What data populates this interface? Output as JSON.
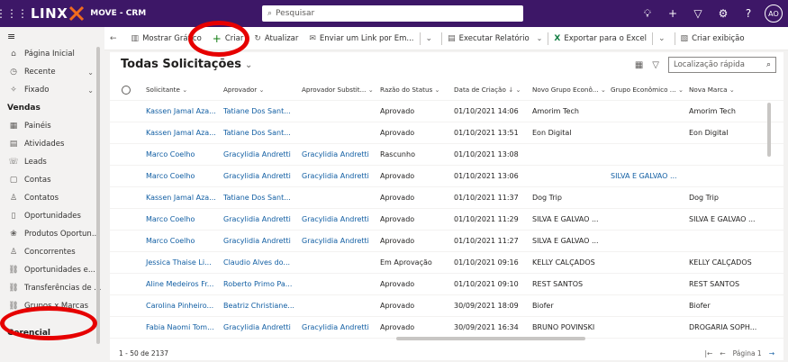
{
  "topbar": {
    "logo_text": "LINX",
    "app_name": "MOVE - CRM",
    "search_placeholder": "Pesquisar",
    "avatar_initials": "AO"
  },
  "sidebar": {
    "items_top": [
      {
        "label": "Página Inicial",
        "icon": "home-icon"
      },
      {
        "label": "Recente",
        "icon": "clock-icon",
        "chevron": true
      },
      {
        "label": "Fixado",
        "icon": "pin-icon",
        "chevron": true
      }
    ],
    "section_vendas": "Vendas",
    "items_vendas": [
      {
        "label": "Painéis",
        "icon": "dashboard-icon"
      },
      {
        "label": "Atividades",
        "icon": "activities-icon"
      },
      {
        "label": "Leads",
        "icon": "leads-icon"
      },
      {
        "label": "Contas",
        "icon": "accounts-icon"
      },
      {
        "label": "Contatos",
        "icon": "contact-icon"
      },
      {
        "label": "Oportunidades",
        "icon": "opportunity-icon"
      },
      {
        "label": "Produtos Oportun...",
        "icon": "products-icon"
      },
      {
        "label": "Concorrentes",
        "icon": "competitor-icon"
      },
      {
        "label": "Oportunidades e...",
        "icon": "link-icon"
      },
      {
        "label": "Transferências de ...",
        "icon": "link-icon"
      },
      {
        "label": "Grupos x Marcas",
        "icon": "link-icon"
      }
    ],
    "section_gerencial": "Gerencial"
  },
  "commands": {
    "mostrar_grafico": "Mostrar Gráfico",
    "criar": "Criar",
    "atualizar": "Atualizar",
    "enviar_link": "Enviar um Link por Em...",
    "executar_relatorio": "Executar Relatório",
    "exportar_excel": "Exportar para o Excel",
    "criar_exibicao": "Criar exibição"
  },
  "view": {
    "title": "Todas Solicitações",
    "quick_find_placeholder": "Localização rápida"
  },
  "grid": {
    "headers": [
      "Solicitante",
      "Aprovador",
      "Aprovador Substit...",
      "Razão do Status",
      "Data de Criação",
      "Novo Grupo Econô...",
      "Grupo Econômico ...",
      "Nova Marca"
    ],
    "rows": [
      [
        "Kassen Jamal Aza...",
        "Tatiane Dos Sant...",
        "",
        "Aprovado",
        "01/10/2021 14:06",
        "Amorim Tech",
        "",
        "Amorim Tech"
      ],
      [
        "Kassen Jamal Aza...",
        "Tatiane Dos Sant...",
        "",
        "Aprovado",
        "01/10/2021 13:51",
        "Eon Digital",
        "",
        "Eon Digital"
      ],
      [
        "Marco Coelho",
        "Gracylidia Andretti",
        "Gracylidia Andretti",
        "Rascunho",
        "01/10/2021 13:08",
        "",
        "",
        ""
      ],
      [
        "Marco Coelho",
        "Gracylidia Andretti",
        "Gracylidia Andretti",
        "Aprovado",
        "01/10/2021 13:06",
        "",
        "SILVA E GALVAO ...",
        ""
      ],
      [
        "Kassen Jamal Aza...",
        "Tatiane Dos Sant...",
        "",
        "Aprovado",
        "01/10/2021 11:37",
        "Dog Trip",
        "",
        "Dog Trip"
      ],
      [
        "Marco Coelho",
        "Gracylidia Andretti",
        "Gracylidia Andretti",
        "Aprovado",
        "01/10/2021 11:29",
        "SILVA E GALVAO ...",
        "",
        "SILVA E GALVAO ..."
      ],
      [
        "Marco Coelho",
        "Gracylidia Andretti",
        "Gracylidia Andretti",
        "Aprovado",
        "01/10/2021 11:27",
        "SILVA E GALVAO ...",
        "",
        ""
      ],
      [
        "Jessica Thaise Li...",
        "Claudio Alves do...",
        "",
        "Em Aprovação",
        "01/10/2021 09:16",
        "KELLY CALÇADOS",
        "",
        "KELLY CALÇADOS"
      ],
      [
        "Aline Medeiros Fr...",
        "Roberto Primo Pa...",
        "",
        "Aprovado",
        "01/10/2021 09:10",
        "REST SANTOS",
        "",
        "REST SANTOS"
      ],
      [
        "Carolina Pinheiro...",
        "Beatriz Christiane...",
        "",
        "Aprovado",
        "30/09/2021 18:09",
        "Biofer",
        "",
        "Biofer"
      ],
      [
        "Fabia Naomi Tom...",
        "Gracylidia Andretti",
        "Gracylidia Andretti",
        "Aprovado",
        "30/09/2021 16:34",
        "BRUNO POVINSKI",
        "",
        "DROGARIA SOPH..."
      ]
    ]
  },
  "footer": {
    "record_count": "1 - 50 de 2137",
    "page_label": "Página 1"
  },
  "colors": {
    "topbar": "#3d1767",
    "link": "#115ea3",
    "annotation": "#e60000"
  }
}
